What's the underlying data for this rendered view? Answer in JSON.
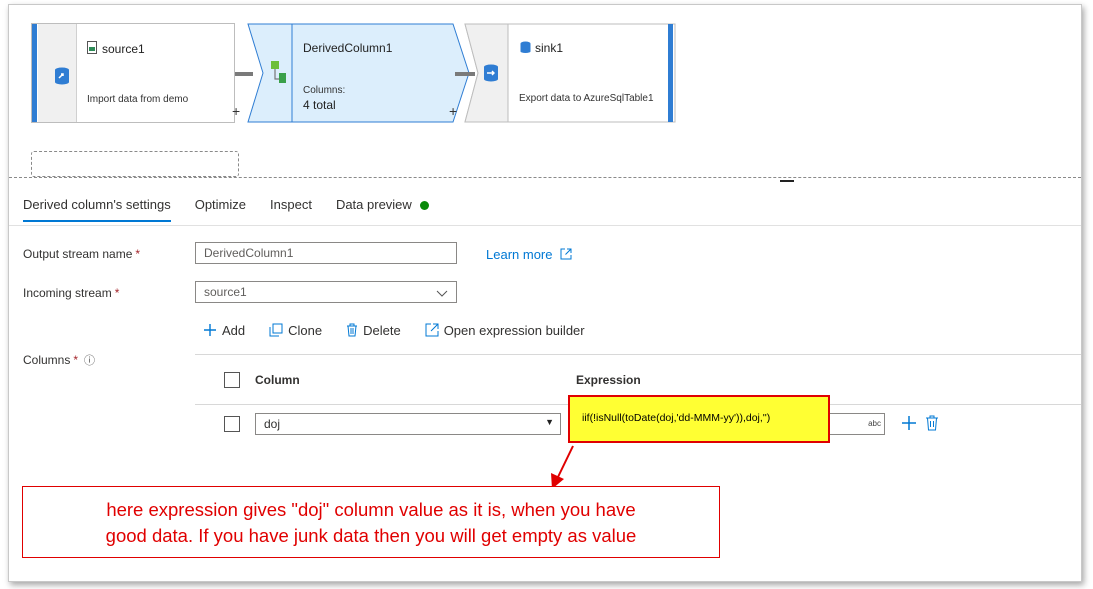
{
  "flow": {
    "nodes": [
      {
        "title": "source1",
        "subtitle": "Import data from demo"
      },
      {
        "title": "DerivedColumn1",
        "columns_label": "Columns:",
        "columns_value": "4 total"
      },
      {
        "title": "sink1",
        "subtitle": "Export data to AzureSqlTable1"
      }
    ],
    "plus": "+"
  },
  "tabs": [
    {
      "label": "Derived column's settings"
    },
    {
      "label": "Optimize"
    },
    {
      "label": "Inspect"
    },
    {
      "label": "Data preview"
    }
  ],
  "form": {
    "output_stream_label": "Output stream name",
    "output_stream_value": "DerivedColumn1",
    "learn_more": "Learn more",
    "incoming_stream_label": "Incoming stream",
    "incoming_stream_value": "source1",
    "columns_label": "Columns",
    "required_mark": "*",
    "info_icon_char": "ⓘ"
  },
  "toolbar": {
    "add": "Add",
    "clone": "Clone",
    "delete": "Delete",
    "open_builder": "Open expression builder"
  },
  "grid": {
    "column_header": "Column",
    "expression_header": "Expression",
    "row": {
      "column_value": "doj",
      "expression_value": "iif(!isNull(toDate(doj,'dd-MMM-yy')),doj,'')",
      "type_badge": "abc"
    }
  },
  "callout": {
    "line1": "here expression gives \"doj\" column value as it is, when you have",
    "line2": "good data. If you have junk data then you will get empty as value"
  },
  "colors": {
    "accent": "#0078d4",
    "annotation_red": "#e00000",
    "highlight_yellow": "#ffff33",
    "status_green": "#0a8a0a"
  }
}
